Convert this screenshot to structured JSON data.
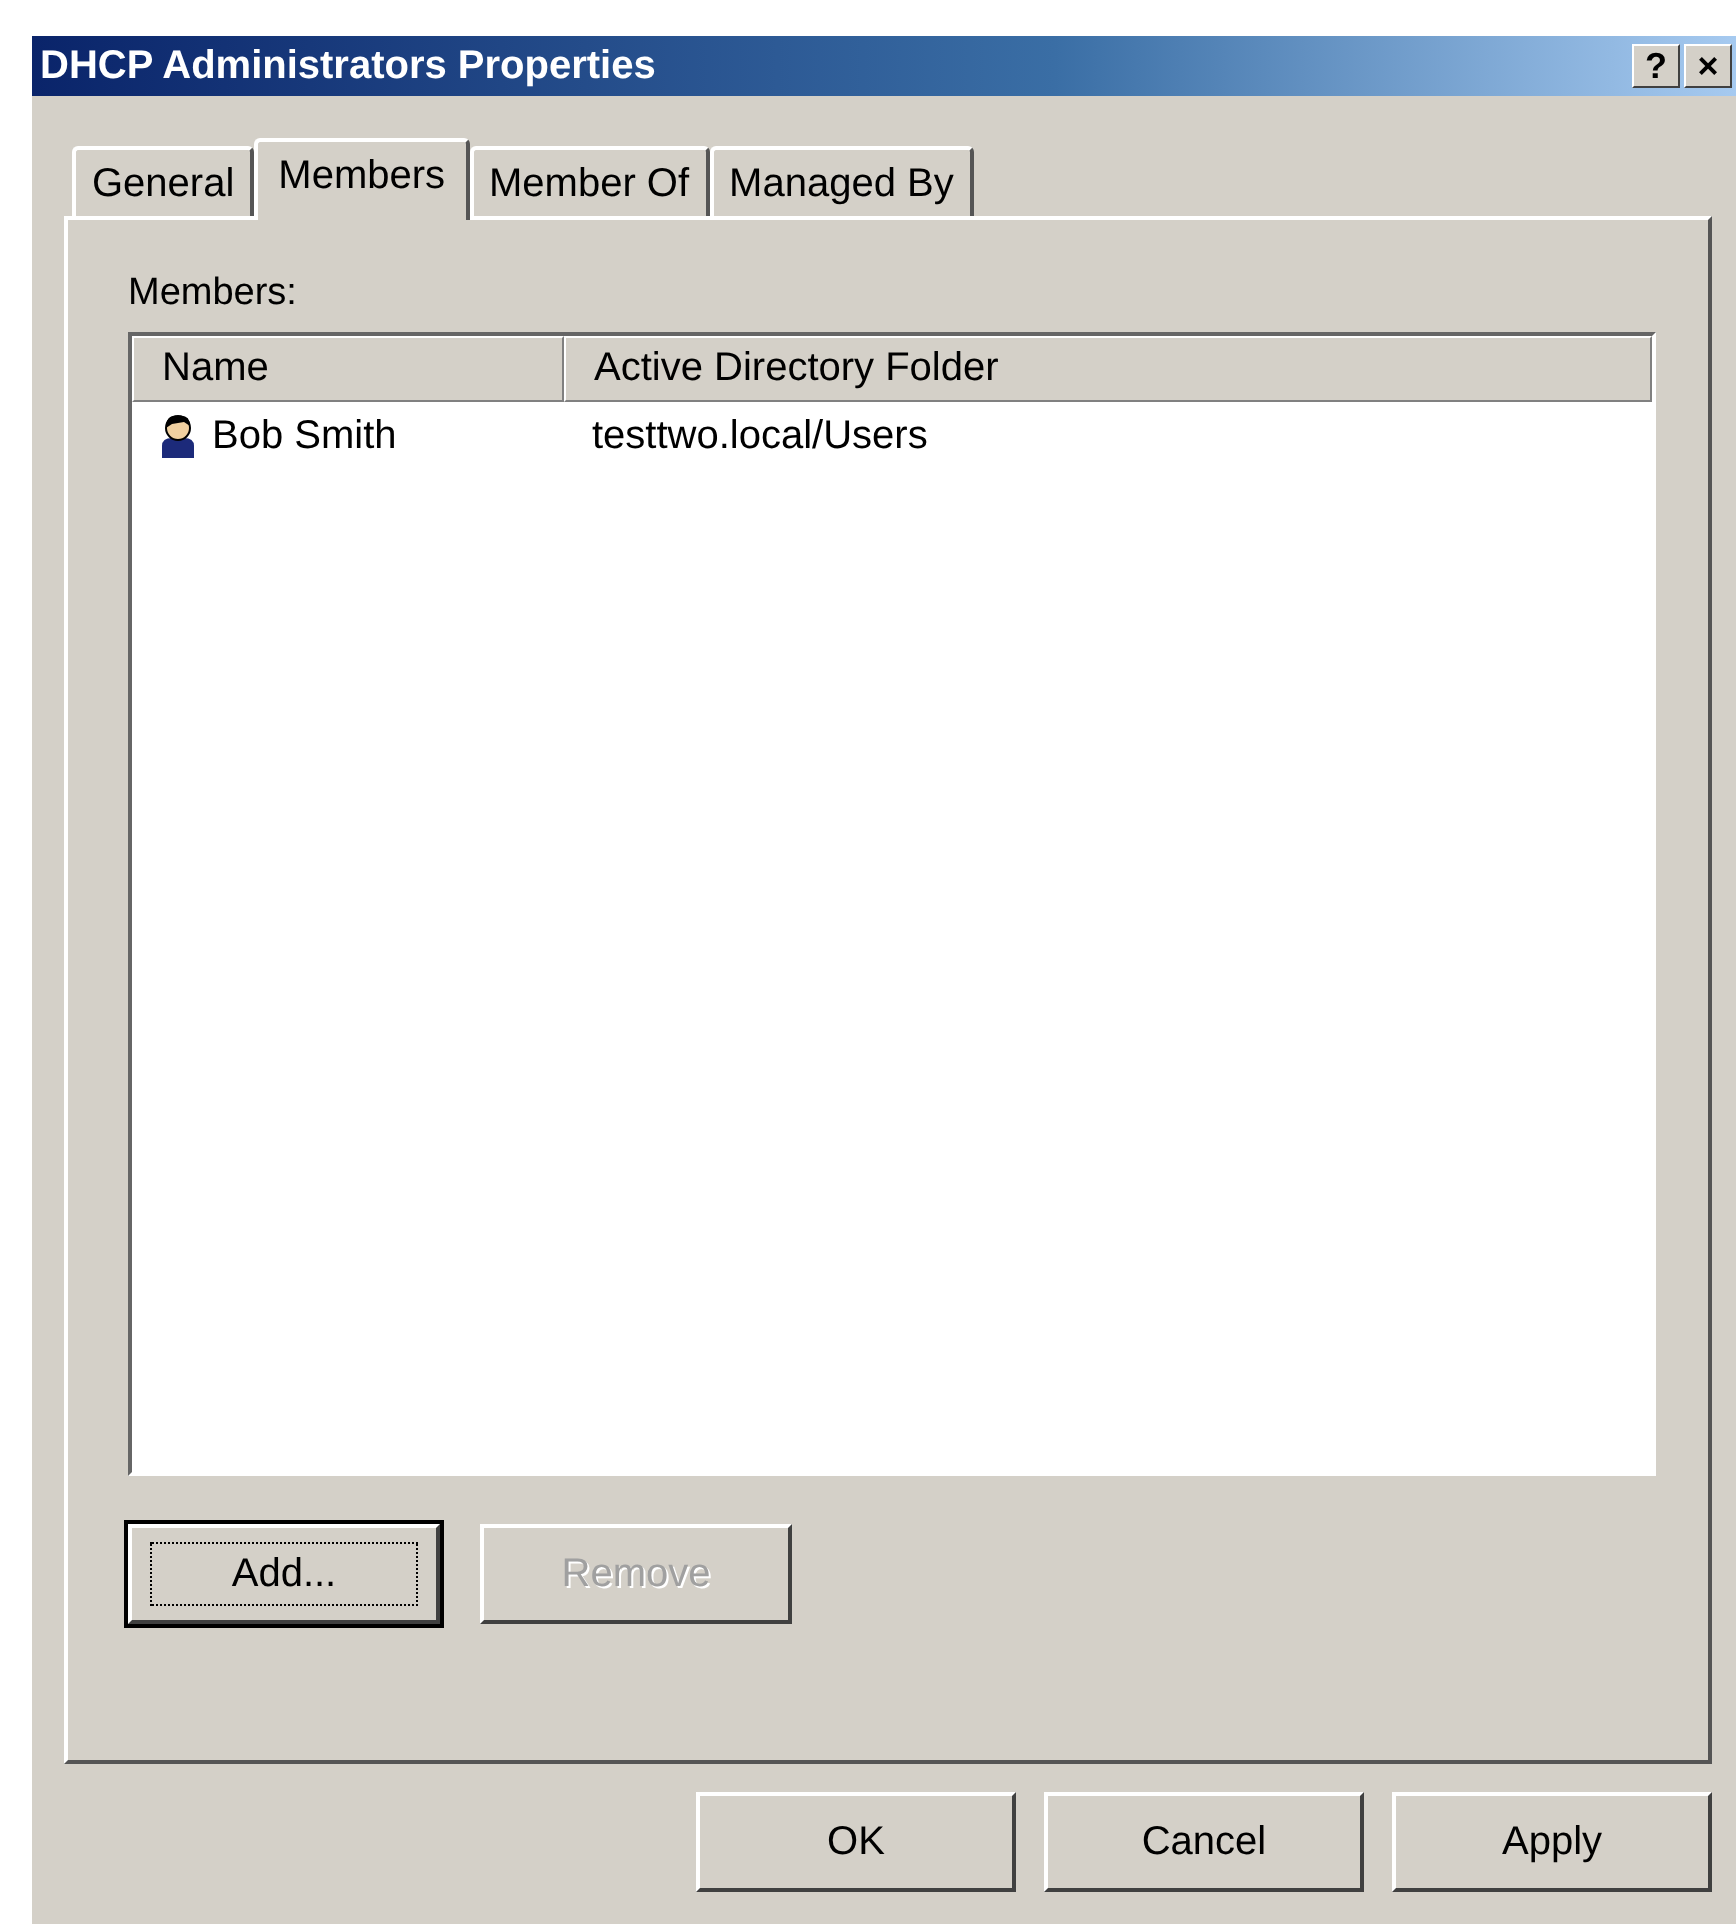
{
  "window": {
    "title": "DHCP Administrators Properties",
    "title_buttons": [
      "?",
      "×"
    ]
  },
  "tabs": [
    {
      "label": "General",
      "selected": false
    },
    {
      "label": "Members",
      "selected": true
    },
    {
      "label": "Member Of",
      "selected": false
    },
    {
      "label": "Managed By",
      "selected": false
    }
  ],
  "members_label": {
    "text": "Members:"
  },
  "table": {
    "columns": [
      "Name",
      "Active Directory Folder"
    ],
    "rows": [
      {
        "name": "Bob Smith",
        "folder": "testtwo.local/Users",
        "selected": false
      }
    ]
  },
  "list_buttons": [
    {
      "label": "Add...",
      "disabled": false,
      "default": true
    },
    {
      "label": "Remove",
      "disabled": true,
      "default": false
    }
  ],
  "dialog_buttons": [
    {
      "label": "OK",
      "disabled": false
    },
    {
      "label": "Cancel",
      "disabled": false
    },
    {
      "label": "Apply",
      "disabled": false
    }
  ]
}
